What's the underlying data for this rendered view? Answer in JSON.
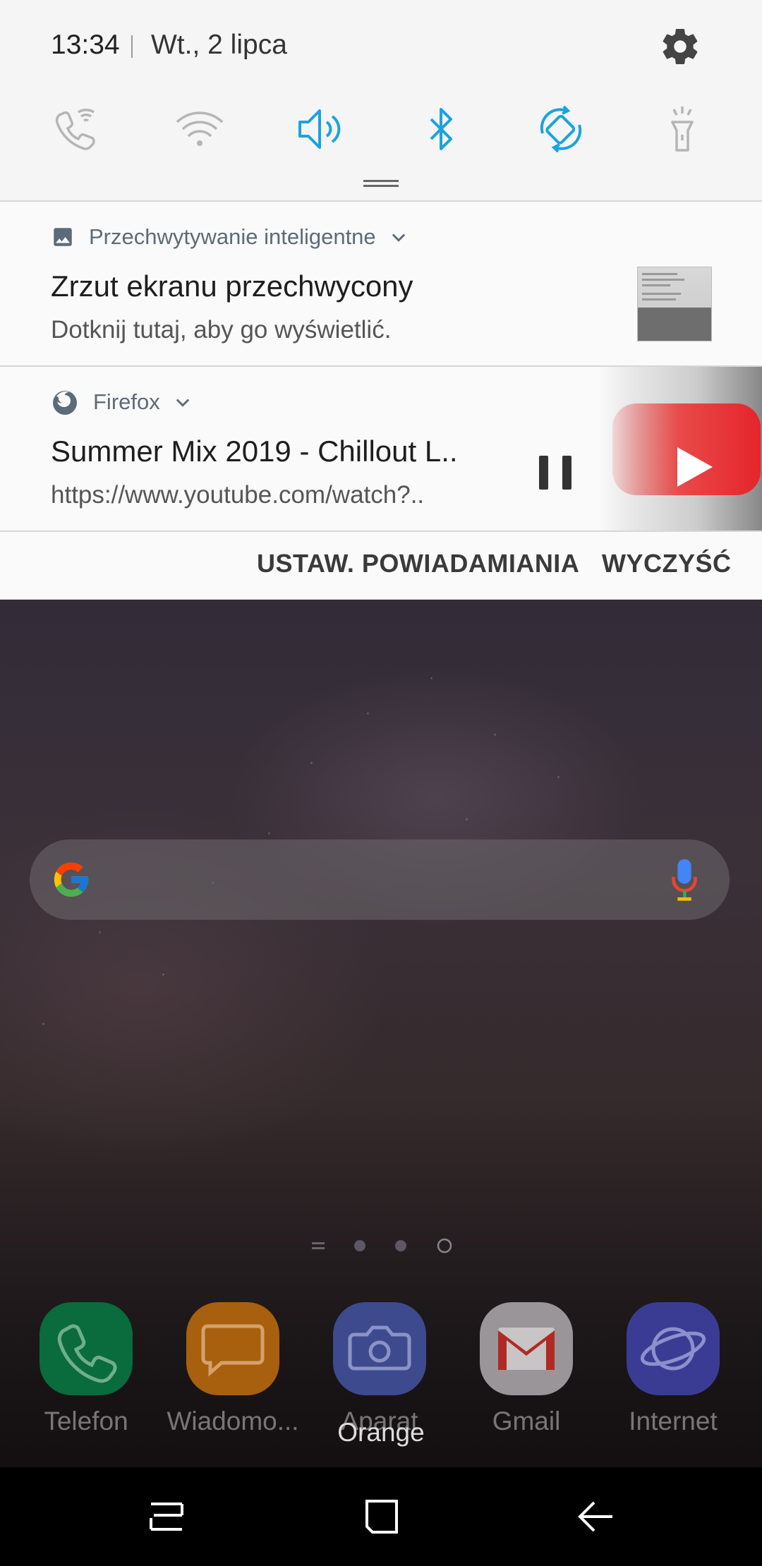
{
  "status_bar": {
    "time": "13:34",
    "date": "Wt., 2 lipca"
  },
  "quick_settings": [
    {
      "icon": "wifi-calling-icon",
      "active": false
    },
    {
      "icon": "wifi-icon",
      "active": false
    },
    {
      "icon": "sound-icon",
      "active": true
    },
    {
      "icon": "bluetooth-icon",
      "active": true
    },
    {
      "icon": "auto-rotate-icon",
      "active": true
    },
    {
      "icon": "flashlight-icon",
      "active": false
    }
  ],
  "colors": {
    "active_icon": "#1aa3dd",
    "inactive_icon": "#b5b5b5"
  },
  "notifications": [
    {
      "app": "Przechwytywanie inteligentne",
      "title": "Zrzut ekranu przechwycony",
      "text": "Dotknij tutaj, aby go wyświetlić."
    },
    {
      "app": "Firefox",
      "title": "Summer Mix 2019 - Chillout L..",
      "text": "https://www.youtube.com/watch?.."
    }
  ],
  "actions": {
    "settings": "USTAW. POWIADAMIANIA",
    "clear": "WYCZYŚĆ"
  },
  "dock": [
    {
      "label": "Telefon",
      "icon": "phone-icon",
      "color": "#0a8a4a"
    },
    {
      "label": "Wiadomo...",
      "icon": "messages-icon",
      "color": "#d77a12"
    },
    {
      "label": "Aparat",
      "icon": "camera-icon",
      "color": "#4a58b8"
    },
    {
      "label": "Gmail",
      "icon": "gmail-icon",
      "color": "#e6e6e6"
    },
    {
      "label": "Internet",
      "icon": "internet-icon",
      "color": "#4c4fc8"
    }
  ],
  "carrier": "Orange"
}
